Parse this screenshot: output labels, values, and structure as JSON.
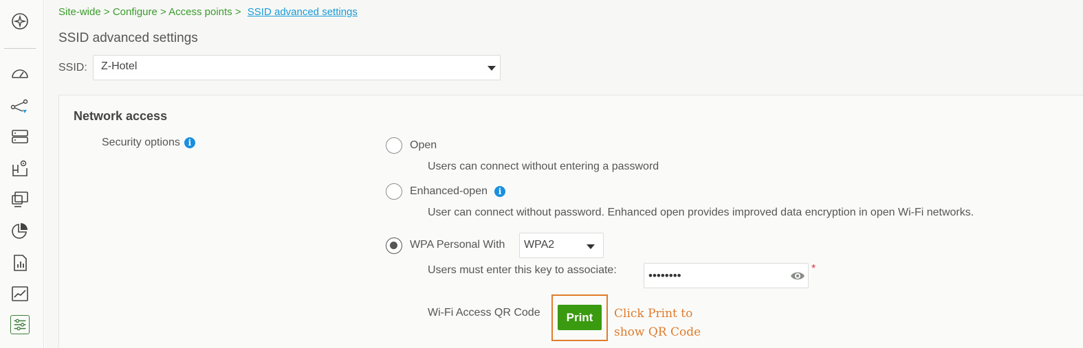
{
  "sidebar": {
    "items": [
      {
        "icon": "ai-assistant-icon"
      },
      {
        "icon": "dashboard-icon"
      },
      {
        "icon": "topology-icon"
      },
      {
        "icon": "devices-icon"
      },
      {
        "icon": "floor-plan-icon"
      },
      {
        "icon": "clients-icon"
      },
      {
        "icon": "applications-icon"
      },
      {
        "icon": "reports-icon"
      },
      {
        "icon": "monitor-icon"
      },
      {
        "icon": "configure-icon"
      }
    ],
    "active_item": "configure-icon"
  },
  "breadcrumb": {
    "items": [
      "Site-wide",
      "Configure",
      "Access points"
    ],
    "separator": ">",
    "current": "SSID advanced settings"
  },
  "page_title": "SSID advanced settings",
  "ssid": {
    "label": "SSID:",
    "selected": "Z-Hotel"
  },
  "network_access": {
    "title": "Network access",
    "security_options_label": "Security options",
    "options": [
      {
        "label": "Open",
        "description": "Users can connect without entering a password",
        "checked": false
      },
      {
        "label": "Enhanced-open",
        "description": "User can connect without password. Enhanced open provides improved data encryption in open Wi-Fi networks.",
        "checked": false
      },
      {
        "label": "WPA Personal With",
        "checked": true
      }
    ],
    "wpa_mode": "WPA2",
    "key_label": "Users must enter this key to associate:",
    "key_value": "••••••••",
    "required_mark": "*",
    "qr_label": "Wi-Fi Access QR Code",
    "print_label": "Print",
    "annotation_line1": "Click Print to",
    "annotation_line2": "show QR Code"
  },
  "colors": {
    "breadcrumb": "#3a9a2a",
    "link": "#1a9ad6",
    "print_button": "#3a9a10",
    "annotation": "#e07b2a",
    "info": "#1a8fe0"
  }
}
